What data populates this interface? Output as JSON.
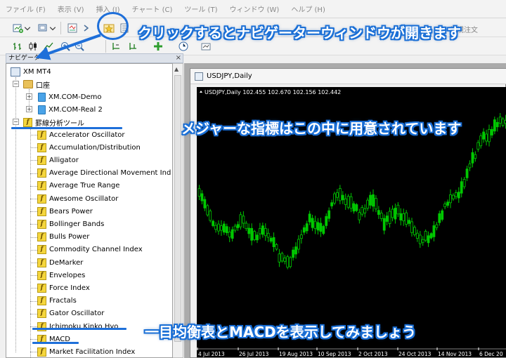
{
  "menu": [
    {
      "label": "ファイル (F)"
    },
    {
      "label": "表示 (V)"
    },
    {
      "label": "挿入 (I)"
    },
    {
      "label": "チャート (C)"
    },
    {
      "label": "ツール (T)"
    },
    {
      "label": "ウィンドウ (W)"
    },
    {
      "label": "ヘルプ (H)"
    }
  ],
  "toolbar": {
    "partial_label": "新規注文"
  },
  "navigator": {
    "title": "ナビゲーター",
    "close": "×",
    "root": "XM MT4",
    "accounts_folder": "口座",
    "accounts": [
      "XM.COM-Demo",
      "XM.COM-Real 2"
    ],
    "indicators_folder": "罫線分析ツール",
    "indicators": [
      "Accelerator Oscillator",
      "Accumulation/Distribution",
      "Alligator",
      "Average Directional Movement Ind",
      "Average True Range",
      "Awesome Oscillator",
      "Bears Power",
      "Bollinger Bands",
      "Bulls Power",
      "Commodity Channel Index",
      "DeMarker",
      "Envelopes",
      "Force Index",
      "Fractals",
      "Gator Oscillator",
      "Ichimoku Kinko Hyo",
      "MACD",
      "Market Facilitation Index"
    ]
  },
  "chart": {
    "window_title": "USDJPY,Daily",
    "info_line": "USDJPY,Daily  102.455 102.670 102.156 102.442",
    "dates": [
      "4 Jul 2013",
      "26 Jul 2013",
      "19 Aug 2013",
      "10 Sep 2013",
      "2 Oct 2013",
      "24 Oct 2013",
      "14 Nov 2013",
      "6 Dec 20"
    ],
    "colors": {
      "candle": "#00c800",
      "background": "#000000",
      "text": "#ffffff"
    }
  },
  "annotations": {
    "navigator_hint": "クリックするとナビゲーターウィンドウが開きます",
    "indicator_hint": "メジャーな指標はこの中に用意されています",
    "select_hint": "一目均衡表とMACDを表示してみましょう",
    "accent_color": "#1e6fd9"
  }
}
